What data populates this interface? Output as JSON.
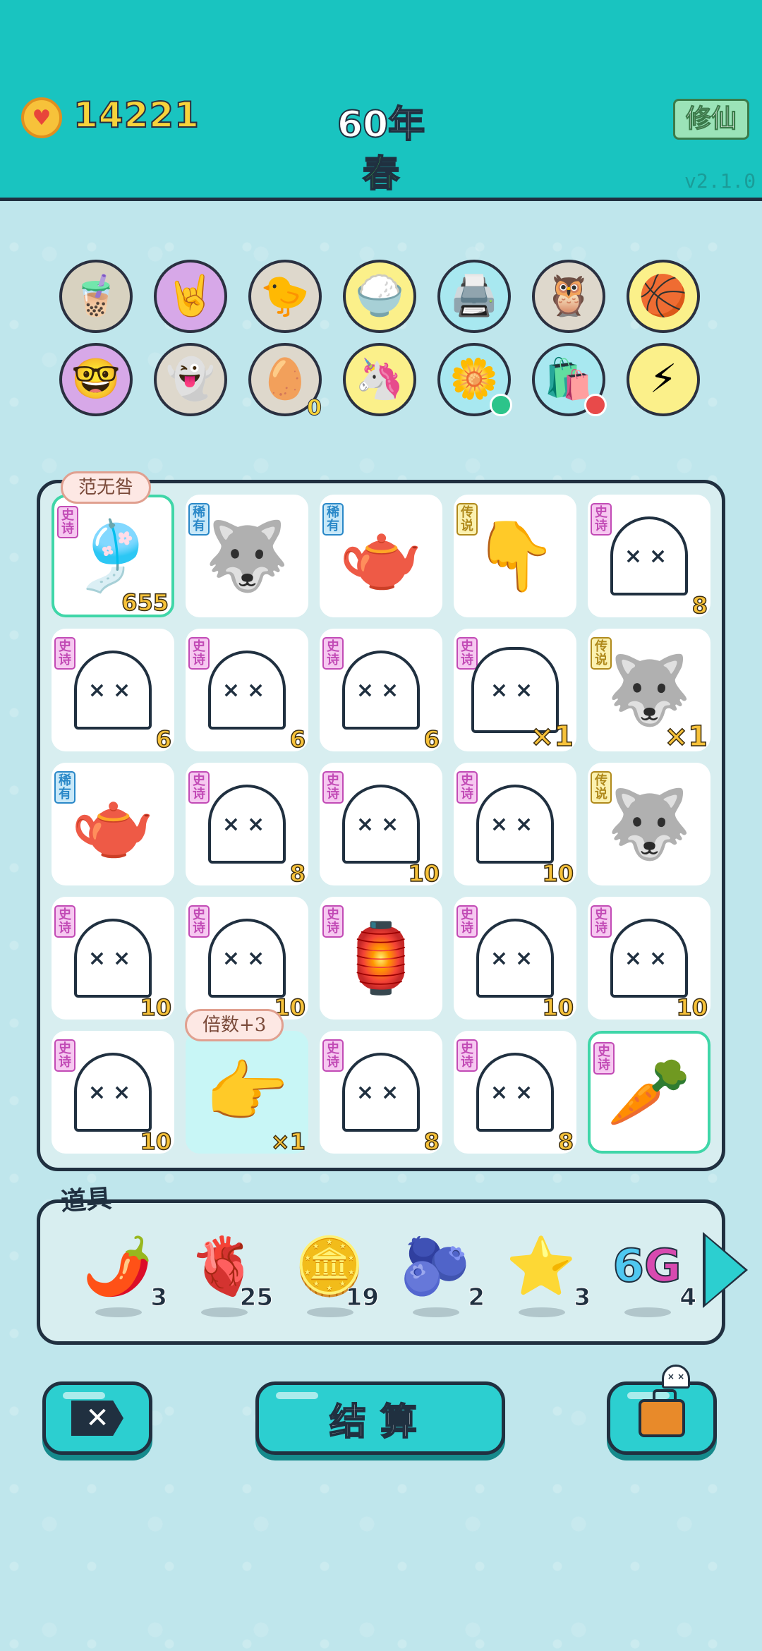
{
  "header": {
    "coins": "14221",
    "year": "60年",
    "season": "春",
    "xiuxian_label": "修仙",
    "version": "v2.1.0",
    "coin_icon": "heart-coin-icon"
  },
  "relics": [
    {
      "name": "bubble-tea-icon",
      "bg": "#d8d2c0",
      "glyph": "🧋"
    },
    {
      "name": "rock-hand-icon",
      "bg": "#d7a8e8",
      "glyph": "🤘"
    },
    {
      "name": "chick-egg-icon",
      "bg": "#ded8cc",
      "glyph": "🐤"
    },
    {
      "name": "rice-bowl-icon",
      "bg": "#fbf08a",
      "glyph": "🍚"
    },
    {
      "name": "printer-icon",
      "bg": "#a8e8f0",
      "glyph": "🖨️"
    },
    {
      "name": "owl-eyes-icon",
      "bg": "#ded8cc",
      "glyph": "🦉"
    },
    {
      "name": "basketballs-icon",
      "bg": "#fbf08a",
      "glyph": "🏀"
    },
    {
      "name": "math-kid-icon",
      "bg": "#d7a8e8",
      "glyph": "🤓"
    },
    {
      "name": "ghost-tongue-icon",
      "bg": "#ded8cc",
      "glyph": "👻"
    },
    {
      "name": "egg-carton-icon",
      "bg": "#ded8cc",
      "glyph": "🥚",
      "count": "0"
    },
    {
      "name": "unicorn-icon",
      "bg": "#fbf08a",
      "glyph": "🦄"
    },
    {
      "name": "flower-pot-icon",
      "bg": "#a8e8f0",
      "glyph": "🌼"
    },
    {
      "name": "trash-bag-icon",
      "bg": "#a8e8f0",
      "glyph": "🛍️"
    },
    {
      "name": "lightning-icon",
      "bg": "#fbf08a",
      "glyph": "⚡"
    }
  ],
  "board": {
    "bubble_top": "范无咎",
    "bubble_mult": "倍数+3",
    "cells": [
      {
        "tag": "史诗",
        "tag_type": "epic",
        "kind": "icon",
        "glyph": "🎐",
        "icon": "black-white-impermanence-icon",
        "count": "655",
        "hl": true
      },
      {
        "tag": "稀有",
        "tag_type": "rare",
        "kind": "icon",
        "glyph": "🐺",
        "icon": "husky-icon",
        "count": ""
      },
      {
        "tag": "稀有",
        "tag_type": "rare",
        "kind": "icon",
        "glyph": "🫖",
        "icon": "teapot-icon",
        "count": ""
      },
      {
        "tag": "传说",
        "tag_type": "legend",
        "kind": "icon",
        "glyph": "👇",
        "icon": "pointing-hand-icon",
        "count": ""
      },
      {
        "tag": "史诗",
        "tag_type": "epic",
        "kind": "ghost",
        "count": "8"
      },
      {
        "tag": "史诗",
        "tag_type": "epic",
        "kind": "ghost",
        "count": "6"
      },
      {
        "tag": "史诗",
        "tag_type": "epic",
        "kind": "ghost",
        "count": "6"
      },
      {
        "tag": "史诗",
        "tag_type": "epic",
        "kind": "ghost",
        "count": "6"
      },
      {
        "tag": "史诗",
        "tag_type": "epic",
        "kind": "ghost",
        "count": "×1",
        "big": true
      },
      {
        "tag": "传说",
        "tag_type": "legend",
        "kind": "icon",
        "glyph": "🐺",
        "icon": "king-husky-icon",
        "count": "×1",
        "big": true
      },
      {
        "tag": "稀有",
        "tag_type": "rare",
        "kind": "icon",
        "glyph": "🫖",
        "icon": "teapot-icon",
        "count": ""
      },
      {
        "tag": "史诗",
        "tag_type": "epic",
        "kind": "ghost",
        "count": "8"
      },
      {
        "tag": "史诗",
        "tag_type": "epic",
        "kind": "ghost",
        "count": "10"
      },
      {
        "tag": "史诗",
        "tag_type": "epic",
        "kind": "ghost",
        "count": "10"
      },
      {
        "tag": "传说",
        "tag_type": "legend",
        "kind": "icon",
        "glyph": "🐺",
        "icon": "king-husky-icon",
        "count": ""
      },
      {
        "tag": "史诗",
        "tag_type": "epic",
        "kind": "ghost",
        "count": "10"
      },
      {
        "tag": "史诗",
        "tag_type": "epic",
        "kind": "ghost",
        "count": "10"
      },
      {
        "tag": "史诗",
        "tag_type": "epic",
        "kind": "icon",
        "glyph": "🏮",
        "icon": "rabbit-lantern-tent-icon",
        "count": ""
      },
      {
        "tag": "史诗",
        "tag_type": "epic",
        "kind": "ghost",
        "count": "10"
      },
      {
        "tag": "史诗",
        "tag_type": "epic",
        "kind": "ghost",
        "count": "10"
      },
      {
        "tag": "史诗",
        "tag_type": "epic",
        "kind": "ghost",
        "count": "10"
      },
      {
        "tag": "",
        "tag_type": "",
        "kind": "icon",
        "glyph": "👉",
        "icon": "pointing-hand-icon",
        "count": "×1",
        "cyan": true
      },
      {
        "tag": "史诗",
        "tag_type": "epic",
        "kind": "ghost",
        "count": "8"
      },
      {
        "tag": "史诗",
        "tag_type": "epic",
        "kind": "ghost",
        "count": "8"
      },
      {
        "tag": "史诗",
        "tag_type": "epic",
        "kind": "icon",
        "glyph": "🥕",
        "icon": "carrot-icon",
        "count": "",
        "hl": true
      }
    ]
  },
  "items": {
    "title": "道具",
    "list": [
      {
        "name": "chili-pepper-icon",
        "glyph": "🌶️",
        "count": "3"
      },
      {
        "name": "liver-icon",
        "glyph": "🫀",
        "count": "25"
      },
      {
        "name": "dollar-coin-icon",
        "glyph": "🪙",
        "count": "19"
      },
      {
        "name": "blueberry-icon",
        "glyph": "🫐",
        "count": "2"
      },
      {
        "name": "star-icon",
        "glyph": "⭐",
        "count": "3"
      },
      {
        "name": "6g-icon",
        "glyph": "6G",
        "count": "4"
      }
    ]
  },
  "actions": {
    "close_label": "✕",
    "settle_label": "结算",
    "bag_icon": "briefcase-icon"
  }
}
